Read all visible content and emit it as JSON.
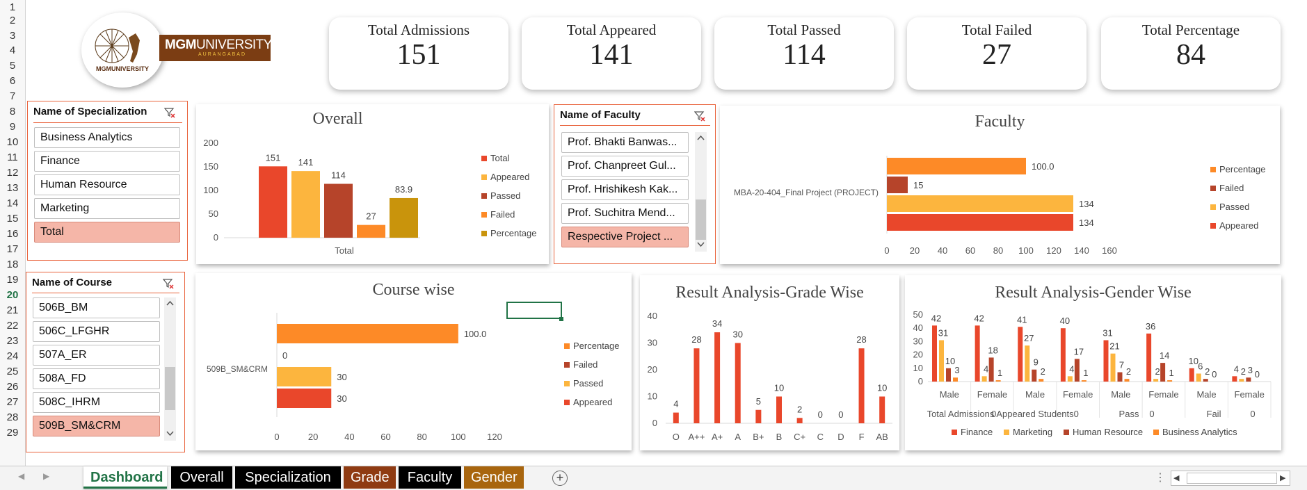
{
  "colors": {
    "appeared": "#e9472b",
    "passed": "#fcb53e",
    "failed": "#b6442a",
    "percentage": "#fd8a27",
    "total": "#e9472b",
    "gold": "#c9940c",
    "business_analytics": "#fd8a27"
  },
  "row_numbers": [
    "1",
    "2",
    "3",
    "4",
    "5",
    "6",
    "7",
    "8",
    "9",
    "10",
    "11",
    "12",
    "13",
    "14",
    "15",
    "16",
    "17",
    "18",
    "19",
    "20",
    "21",
    "22",
    "23",
    "24",
    "25",
    "26",
    "27",
    "28",
    "29"
  ],
  "logo": {
    "text_main": "MGMUNIVERSITY",
    "text_mgm": "MGM",
    "text_univ": "UNIVERSITY",
    "text_sub": "AURANGABAD",
    "emblem_text": "MGMUNIVERSITY"
  },
  "kpis": [
    {
      "label": "Total Admissions",
      "value": "151"
    },
    {
      "label": "Total Appeared",
      "value": "141"
    },
    {
      "label": "Total Passed",
      "value": "114"
    },
    {
      "label": "Total Failed",
      "value": "27"
    },
    {
      "label": "Total Percentage",
      "value": "84"
    }
  ],
  "specialization_slicer": {
    "title": "Name of Specialization",
    "items": [
      "Business Analytics",
      "Finance",
      "Human Resource",
      "Marketing",
      "Total"
    ],
    "selected": "Total"
  },
  "course_slicer": {
    "title": "Name of Course",
    "items": [
      "506B_BM",
      "506C_LFGHR",
      "507A_ER",
      "508A_FD",
      "508C_IHRM",
      "509B_SM&CRM"
    ],
    "selected": "509B_SM&CRM"
  },
  "faculty_slicer": {
    "title": "Name of Faculty",
    "items": [
      "Prof. Bhakti Banwas...",
      "Prof. Chanpreet Gul...",
      "Prof. Hrishikesh Kak...",
      "Prof. Suchitra Mend...",
      "Respective Project ..."
    ],
    "selected": "Respective Project ..."
  },
  "chart_data": [
    {
      "id": "overall",
      "type": "bar",
      "title": "Overall",
      "categories": [
        "Total"
      ],
      "series": [
        {
          "name": "Total",
          "values": [
            151
          ],
          "label": "151"
        },
        {
          "name": "Appeared",
          "values": [
            141
          ],
          "label": "141"
        },
        {
          "name": "Passed",
          "values": [
            114
          ],
          "label": "114"
        },
        {
          "name": "Failed",
          "values": [
            27
          ],
          "label": "27"
        },
        {
          "name": "Percentage",
          "values": [
            83.9
          ],
          "label": "83.9"
        }
      ],
      "yticks": [
        "0",
        "50",
        "100",
        "150",
        "200"
      ],
      "ylim": [
        0,
        200
      ],
      "legend": "right"
    },
    {
      "id": "faculty",
      "type": "bar",
      "orientation": "horizontal",
      "title": "Faculty",
      "categories": [
        "MBA-20-404_Final Project (PROJECT)"
      ],
      "series": [
        {
          "name": "Percentage",
          "values": [
            100.0
          ],
          "label": "100.0"
        },
        {
          "name": "Failed",
          "values": [
            15
          ],
          "label": "15"
        },
        {
          "name": "Passed",
          "values": [
            134
          ],
          "label": "134"
        },
        {
          "name": "Appeared",
          "values": [
            134
          ],
          "label": "134"
        }
      ],
      "xticks": [
        "0",
        "20",
        "40",
        "60",
        "80",
        "100",
        "120",
        "140",
        "160"
      ],
      "xlim": [
        0,
        160
      ],
      "legend": "right"
    },
    {
      "id": "course",
      "type": "bar",
      "orientation": "horizontal",
      "title": "Course wise",
      "categories": [
        "509B_SM&CRM"
      ],
      "series": [
        {
          "name": "Percentage",
          "values": [
            100.0
          ],
          "label": "100.0"
        },
        {
          "name": "Failed",
          "values": [
            0
          ],
          "label": "0"
        },
        {
          "name": "Passed",
          "values": [
            30
          ],
          "label": "30"
        },
        {
          "name": "Appeared",
          "values": [
            30
          ],
          "label": "30"
        }
      ],
      "xticks": [
        "0",
        "20",
        "40",
        "60",
        "80",
        "100",
        "120"
      ],
      "xlim": [
        0,
        120
      ],
      "legend": "right"
    },
    {
      "id": "grade",
      "type": "bar",
      "title": "Result Analysis-Grade Wise",
      "categories": [
        "O",
        "A++",
        "A+",
        "A",
        "B+",
        "B",
        "C+",
        "C",
        "D",
        "F",
        "AB"
      ],
      "values": [
        4,
        28,
        34,
        30,
        5,
        10,
        2,
        0,
        0,
        28,
        10
      ],
      "yticks": [
        "0",
        "10",
        "20",
        "30",
        "40"
      ],
      "ylim": [
        0,
        40
      ]
    },
    {
      "id": "gender",
      "type": "bar",
      "title": "Result Analysis-Gender Wise",
      "groups": [
        {
          "label": "Total Admissions",
          "subs": [
            "Male",
            "Female"
          ]
        },
        {
          "label": "0Appeared Students0",
          "subs": [
            "Male",
            "Female"
          ]
        },
        {
          "label": "Pass",
          "subs": [
            "Male",
            "Female"
          ]
        },
        {
          "label": "0",
          "subs": []
        },
        {
          "label": "Fail",
          "subs": [
            "Male",
            "Female"
          ]
        },
        {
          "label": "0",
          "subs": []
        }
      ],
      "x_sub_labels": [
        "Male",
        "Female",
        "Male",
        "Female",
        "Male",
        "Female",
        "Male",
        "Female"
      ],
      "x_group_labels": [
        "Total Admissions",
        "0Appeared Students0",
        "Pass",
        "0",
        "Fail",
        "0"
      ],
      "series": [
        {
          "name": "Finance",
          "values": [
            42,
            42,
            41,
            40,
            31,
            36,
            10,
            4
          ]
        },
        {
          "name": "Marketing",
          "values": [
            31,
            4,
            27,
            4,
            21,
            2,
            6,
            2
          ]
        },
        {
          "name": "Human Resource",
          "values": [
            10,
            18,
            9,
            17,
            7,
            14,
            2,
            3
          ]
        },
        {
          "name": "Business Analytics",
          "values": [
            3,
            1,
            2,
            1,
            2,
            1,
            0,
            0
          ]
        }
      ],
      "yticks": [
        "0",
        "10",
        "20",
        "30",
        "40",
        "50"
      ],
      "ylim": [
        0,
        50
      ],
      "legend": "bottom"
    }
  ],
  "tabs": [
    {
      "label": "Dashboard",
      "active": true
    },
    {
      "label": "Overall"
    },
    {
      "label": "Specialization"
    },
    {
      "label": "Grade"
    },
    {
      "label": "Faculty"
    },
    {
      "label": "Gender"
    }
  ],
  "tabbar": {
    "add_symbol": "+",
    "prev_symbol": "◀",
    "next_symbol": "▶",
    "dots": "⋮"
  },
  "cell_selected_row": "20"
}
